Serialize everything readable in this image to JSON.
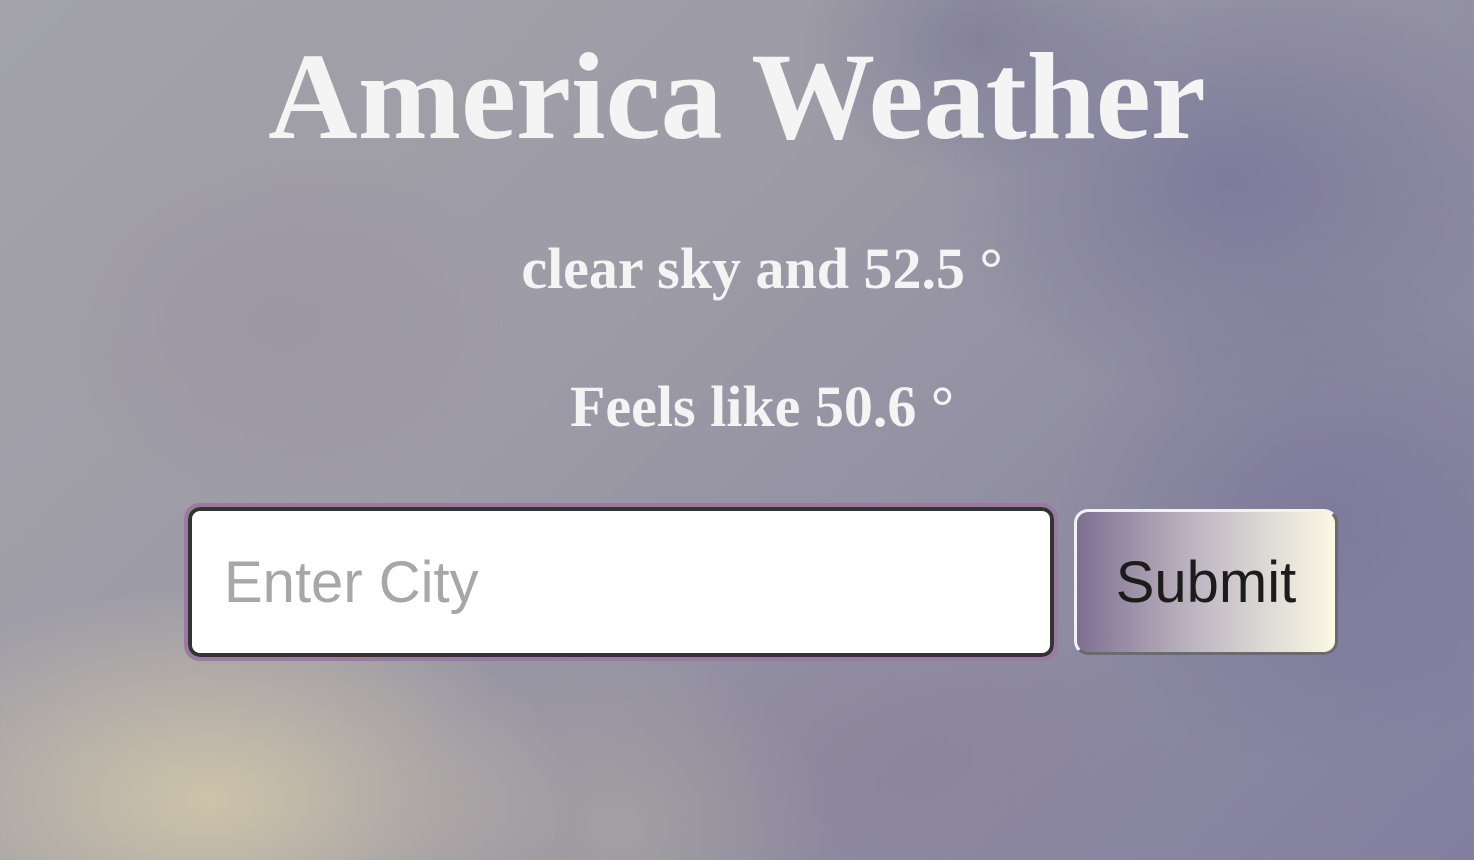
{
  "header": {
    "title": "America Weather"
  },
  "weather": {
    "description_line": "clear sky and 52.5 °",
    "feels_like_line": "Feels like 50.6 °"
  },
  "form": {
    "city_placeholder": "Enter City",
    "city_value": "",
    "submit_label": "Submit"
  }
}
